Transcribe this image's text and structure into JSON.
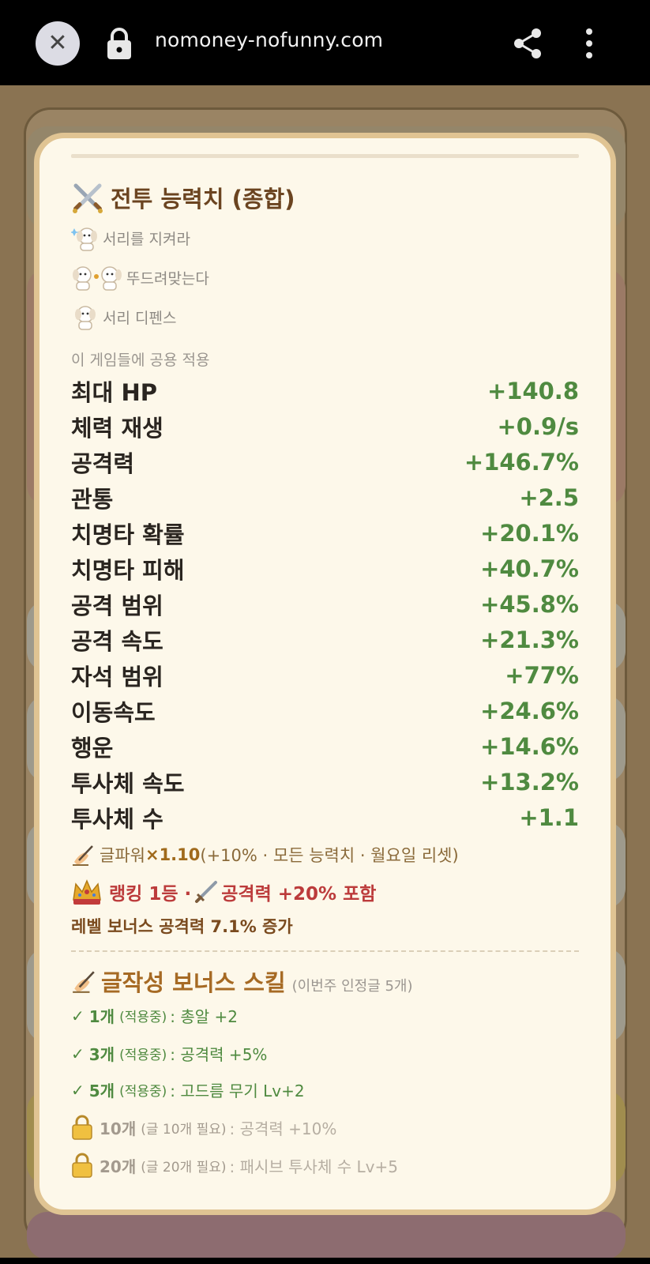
{
  "browser": {
    "url": "nomoney-nofunny.com"
  },
  "panel": {
    "title": "전투 능력치 (종합)",
    "games": [
      {
        "label": "서리를 지켜라"
      },
      {
        "label": "뚜드려맞는다"
      },
      {
        "label": "서리 디펜스"
      }
    ],
    "applies_note": "이 게임들에 공용 적용",
    "stats": [
      {
        "label": "최대 HP",
        "value": "+140.8"
      },
      {
        "label": "체력 재생",
        "value": "+0.9/s"
      },
      {
        "label": "공격력",
        "value": "+146.7%"
      },
      {
        "label": "관통",
        "value": "+2.5"
      },
      {
        "label": "치명타 확률",
        "value": "+20.1%"
      },
      {
        "label": "치명타 피해",
        "value": "+40.7%"
      },
      {
        "label": "공격 범위",
        "value": "+45.8%"
      },
      {
        "label": "공격 속도",
        "value": "+21.3%"
      },
      {
        "label": "자석 범위",
        "value": "+77%"
      },
      {
        "label": "이동속도",
        "value": "+24.6%"
      },
      {
        "label": "행운",
        "value": "+14.6%"
      },
      {
        "label": "투사체 속도",
        "value": "+13.2%"
      },
      {
        "label": "투사체 수",
        "value": "+1.1"
      }
    ],
    "power": {
      "prefix": "글파워 ",
      "multiplier": "×1.10",
      "detail": " (+10% · 모든 능력치 · 월요일 리셋)"
    },
    "rank": {
      "prefix": "랭킹 1등 · ",
      "suffix": " 공격력 +20% 포함"
    },
    "level_bonus": "레벨 보너스 공격력 7.1% 증가",
    "skills": {
      "title": "글작성 보너스 스킬",
      "subtitle": "(이번주 인정글 5개)",
      "items": [
        {
          "check": "✓",
          "count": "1개",
          "state": "(적용중)",
          "effect": ": 총알 +2"
        },
        {
          "check": "✓",
          "count": "3개",
          "state": "(적용중)",
          "effect": ": 공격력 +5%"
        },
        {
          "check": "✓",
          "count": "5개",
          "state": "(적용중)",
          "effect": ": 고드름 무기 Lv+2"
        },
        {
          "count": "10개",
          "state": "(글 10개 필요)",
          "effect": ": 공격력 +10%"
        },
        {
          "count": "20개",
          "state": "(글 20개 필요)",
          "effect": ": 패시브 투사체 수 Lv+5"
        }
      ]
    }
  },
  "colors": {
    "stat_value": "#4f8a40",
    "title": "#6b4420",
    "rank": "#bc3b3b",
    "modal_bg": "#fdf8ea",
    "modal_border": "#e0c493"
  }
}
